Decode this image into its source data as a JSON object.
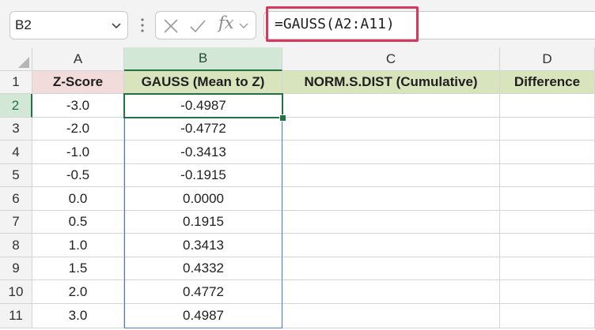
{
  "formula_bar": {
    "name_box": "B2",
    "formula": "=GAUSS(A2:A11)",
    "icons": [
      "chevron-down-icon",
      "kebab-icon",
      "cancel-x-icon",
      "enter-check-icon",
      "fx-icon"
    ],
    "fx_label": "fx"
  },
  "sheet": {
    "columns": [
      "A",
      "B",
      "C",
      "D"
    ],
    "selected_column": "B",
    "selected_row": "2",
    "row_numbers": [
      "1",
      "2",
      "3",
      "4",
      "5",
      "6",
      "7",
      "8",
      "9",
      "10",
      "11"
    ],
    "headers": {
      "A": "Z-Score",
      "B": "GAUSS (Mean to Z)",
      "C": "NORM.S.DIST (Cumulative)",
      "D": "Difference"
    },
    "data": [
      {
        "a": "-3.0",
        "b": "-0.4987",
        "c": "",
        "d": ""
      },
      {
        "a": "-2.0",
        "b": "-0.4772",
        "c": "",
        "d": ""
      },
      {
        "a": "-1.0",
        "b": "-0.3413",
        "c": "",
        "d": ""
      },
      {
        "a": "-0.5",
        "b": "-0.1915",
        "c": "",
        "d": ""
      },
      {
        "a": "0.0",
        "b": "0.0000",
        "c": "",
        "d": ""
      },
      {
        "a": "0.5",
        "b": "0.1915",
        "c": "",
        "d": ""
      },
      {
        "a": "1.0",
        "b": "0.3413",
        "c": "",
        "d": ""
      },
      {
        "a": "1.5",
        "b": "0.4332",
        "c": "",
        "d": ""
      },
      {
        "a": "2.0",
        "b": "0.4772",
        "c": "",
        "d": ""
      },
      {
        "a": "3.0",
        "b": "0.4987",
        "c": "",
        "d": ""
      }
    ]
  },
  "colors": {
    "accent_green": "#217346",
    "highlight_red": "#d7385e",
    "header_pink": "#f2dcdb",
    "header_green": "#d8e4bc",
    "selection_blue": "#4a7ebb"
  }
}
